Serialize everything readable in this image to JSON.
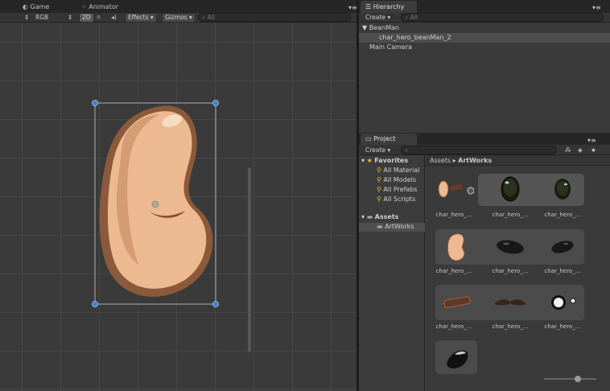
{
  "scene": {
    "tabs": [
      {
        "label": "Game",
        "active": false
      },
      {
        "label": "Animator",
        "active": false
      }
    ],
    "toolbar": {
      "render_mode": "RGB",
      "mode_2d": "2D",
      "effects": "Effects",
      "gizmos": "Gizmos",
      "search_placeholder": "All"
    },
    "selected_object_name": "char_hero_beanMan_2"
  },
  "hierarchy": {
    "tab_label": "Hierarchy",
    "create_label": "Create",
    "search_placeholder": "All",
    "items": [
      {
        "label": "BeanMan",
        "expanded": true
      },
      {
        "label": "char_hero_beanMan_2",
        "selected": true
      },
      {
        "label": "Main Camera"
      }
    ]
  },
  "project": {
    "tab_label": "Project",
    "create_label": "Create",
    "tree": {
      "favorites_label": "Favorites",
      "favorites": [
        "All Material",
        "All Models",
        "All Prefabs",
        "All Scripts"
      ],
      "assets_label": "Assets",
      "folders": [
        "ArtWorks"
      ]
    },
    "breadcrumb": {
      "root": "Assets",
      "current": "ArtWorks"
    },
    "asset_labels": [
      "char_hero_...",
      "char_hero_...",
      "char_hero_...",
      "char_hero_...",
      "char_hero_...",
      "char_hero_...",
      "char_hero_...",
      "char_hero_...",
      "char_hero_..."
    ]
  },
  "colors": {
    "bean_fill": "#ecb991",
    "bean_outline": "#8a5a3a",
    "gizmo_blue": "#3d7fd6",
    "panel_bg": "#3a3a3a"
  }
}
